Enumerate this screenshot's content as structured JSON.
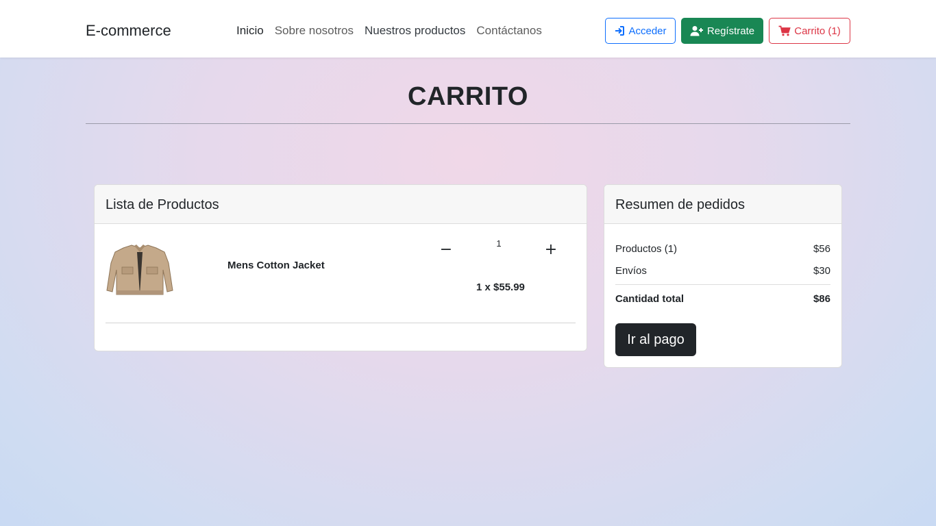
{
  "navbar": {
    "brand": "E-commerce",
    "links": [
      "Inicio",
      "Sobre nosotros",
      "Nuestros productos",
      "Contáctanos"
    ],
    "login_label": "Acceder",
    "register_label": "Regístrate",
    "cart_label": "Carrito (1)"
  },
  "page": {
    "title": "CARRITO"
  },
  "products": {
    "header": "Lista de Productos",
    "items": [
      {
        "name": "Mens Cotton Jacket",
        "quantity": "1",
        "qty_minus": "−",
        "qty_plus": "+",
        "line_total": "1 x $55.99"
      }
    ]
  },
  "summary": {
    "header": "Resumen de pedidos",
    "products_label": "Productos (1)",
    "products_value": "$56",
    "shipping_label": "Envíos",
    "shipping_value": "$30",
    "total_label": "Cantidad total",
    "total_value": "$86",
    "checkout_label": "Ir al pago"
  },
  "colors": {
    "primary": "#0d6efd",
    "success": "#198754",
    "danger": "#dc3545",
    "dark": "#212529"
  },
  "icons": {
    "login": "sign-in-icon",
    "register": "user-plus-icon",
    "cart": "cart-icon",
    "product": "jacket-image"
  }
}
